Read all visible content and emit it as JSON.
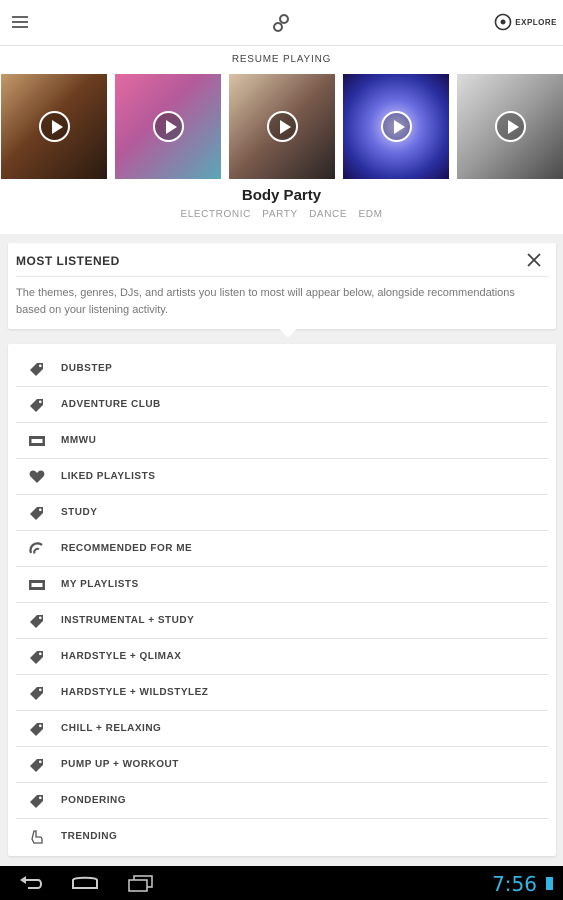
{
  "header": {
    "menu_icon": "hamburger-menu-icon",
    "logo_icon": "link-logo-icon",
    "explore_label": "EXPLORE"
  },
  "resume": {
    "title": "RESUME PLAYING",
    "covers": [
      {
        "name": "whiskey-bottles",
        "bg": "#6b3d20"
      },
      {
        "name": "pink-smoke",
        "bg": "#c26b9c"
      },
      {
        "name": "party-people",
        "bg": "#7a5b4d"
      },
      {
        "name": "blue-mask",
        "bg": "#3b4fb0"
      },
      {
        "name": "bw-diver",
        "bg": "#9a9a9a"
      }
    ],
    "now_playing": "Body Party",
    "tags": [
      "ELECTRONIC",
      "PARTY",
      "DANCE",
      "EDM"
    ]
  },
  "most_listened": {
    "title": "MOST LISTENED",
    "description": "The themes, genres, DJs, and artists you listen to most will appear below, alongside recommendations based on your listening activity."
  },
  "list": [
    {
      "label": "DUBSTEP",
      "icon": "tag-icon"
    },
    {
      "label": "ADVENTURE CLUB",
      "icon": "tag-icon"
    },
    {
      "label": "MMWU",
      "icon": "cassette-icon"
    },
    {
      "label": "LIKED PLAYLISTS",
      "icon": "heart-icon"
    },
    {
      "label": "STUDY",
      "icon": "tag-icon"
    },
    {
      "label": "RECOMMENDED FOR ME",
      "icon": "recommend-icon"
    },
    {
      "label": "MY PLAYLISTS",
      "icon": "cassette-icon"
    },
    {
      "label": "INSTRUMENTAL + STUDY",
      "icon": "tag-icon"
    },
    {
      "label": "HARDSTYLE + QLIMAX",
      "icon": "tag-icon"
    },
    {
      "label": "HARDSTYLE + WILDSTYLEZ",
      "icon": "tag-icon"
    },
    {
      "label": "CHILL + RELAXING",
      "icon": "tag-icon"
    },
    {
      "label": "PUMP UP + WORKOUT",
      "icon": "tag-icon"
    },
    {
      "label": "PONDERING",
      "icon": "tag-icon"
    },
    {
      "label": "TRENDING",
      "icon": "trending-icon"
    }
  ],
  "statusbar": {
    "time": "7:56",
    "accent": "#33b5e5"
  }
}
